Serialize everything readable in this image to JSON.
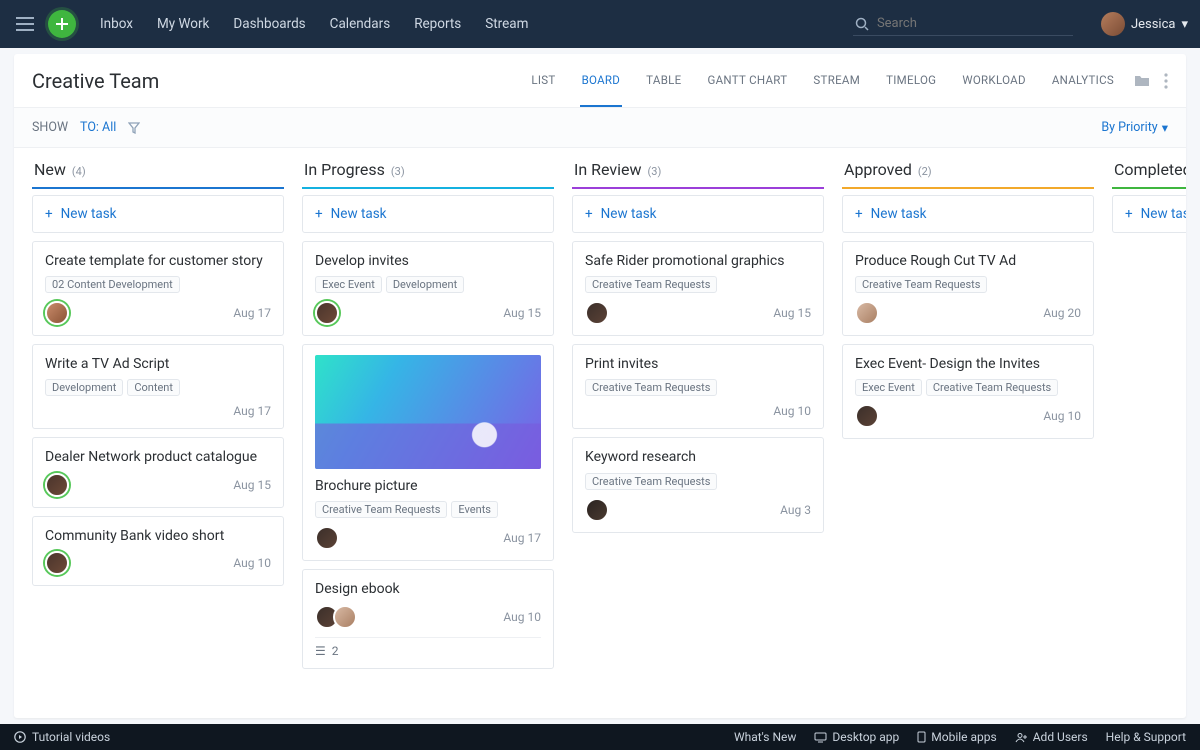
{
  "topnav": {
    "items": [
      "Inbox",
      "My Work",
      "Dashboards",
      "Calendars",
      "Reports",
      "Stream"
    ],
    "search_placeholder": "Search",
    "user_name": "Jessica"
  },
  "page": {
    "title": "Creative Team",
    "tabs": [
      "LIST",
      "BOARD",
      "TABLE",
      "GANTT CHART",
      "STREAM",
      "TIMELOG",
      "WORKLOAD",
      "ANALYTICS"
    ],
    "active_tab": "BOARD"
  },
  "filter": {
    "show_label": "SHOW",
    "to_label": "TO: All",
    "sort_label": "By Priority"
  },
  "new_task_label": "New task",
  "columns": [
    {
      "id": "new",
      "title": "New",
      "count": "(4)",
      "accent": "accent-new",
      "cards": [
        {
          "title": "Create template for customer story",
          "tags": [
            "02 Content Development"
          ],
          "date": "Aug 17",
          "avatars": [
            "c1 ring-g"
          ]
        },
        {
          "title": "Write a TV Ad Script",
          "tags": [
            "Development",
            "Content"
          ],
          "date": "Aug 17",
          "avatars": []
        },
        {
          "title": "Dealer Network product catalogue",
          "tags": [],
          "date": "Aug 15",
          "avatars": [
            "c2 ring-g"
          ]
        },
        {
          "title": "Community Bank video short",
          "tags": [],
          "date": "Aug 10",
          "avatars": [
            "c2 ring-g"
          ]
        }
      ]
    },
    {
      "id": "progress",
      "title": "In Progress",
      "count": "(3)",
      "accent": "accent-progress",
      "cards": [
        {
          "title": "Develop invites",
          "tags": [
            "Exec Event",
            "Development"
          ],
          "date": "Aug 15",
          "avatars": [
            "c2 ring-g"
          ]
        },
        {
          "title": "Brochure picture",
          "tags": [
            "Creative Team Requests",
            "Events"
          ],
          "date": "Aug 17",
          "avatars": [
            "c3"
          ],
          "image": true
        },
        {
          "title": "Design ebook",
          "tags": [],
          "date": "Aug 10",
          "avatars": [
            "c3",
            "c4"
          ],
          "subtasks": "2"
        }
      ]
    },
    {
      "id": "review",
      "title": "In Review",
      "count": "(3)",
      "accent": "accent-review",
      "cards": [
        {
          "title": "Safe Rider promotional graphics",
          "tags": [
            "Creative Team Requests"
          ],
          "date": "Aug 15",
          "avatars": [
            "c3"
          ]
        },
        {
          "title": "Print invites",
          "tags": [
            "Creative Team Requests"
          ],
          "date": "Aug 10",
          "avatars": []
        },
        {
          "title": "Keyword research",
          "tags": [
            "Creative Team Requests"
          ],
          "date": "Aug 3",
          "avatars": [
            "c5"
          ]
        }
      ]
    },
    {
      "id": "approved",
      "title": "Approved",
      "count": "(2)",
      "accent": "accent-approved",
      "cards": [
        {
          "title": "Produce Rough Cut TV Ad",
          "tags": [
            "Creative Team Requests"
          ],
          "date": "Aug 20",
          "avatars": [
            "c4"
          ]
        },
        {
          "title": "Exec Event- Design the Invites",
          "tags": [
            "Exec Event",
            "Creative Team Requests"
          ],
          "date": "Aug 10",
          "avatars": [
            "c3"
          ]
        }
      ]
    },
    {
      "id": "completed",
      "title": "Completed",
      "count": "",
      "accent": "accent-completed",
      "cards": []
    }
  ],
  "footer": {
    "tutorial": "Tutorial videos",
    "links": [
      "What's New",
      "Desktop app",
      "Mobile apps",
      "Add Users",
      "Help & Support"
    ]
  }
}
